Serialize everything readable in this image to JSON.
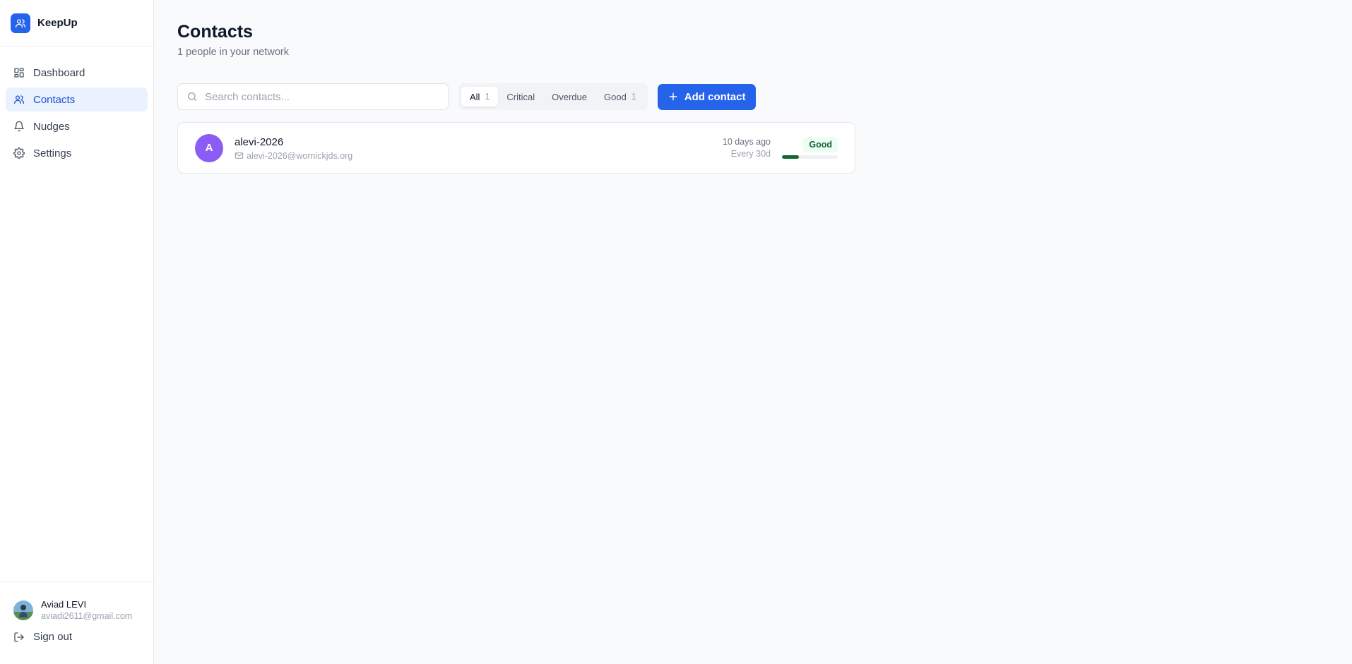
{
  "app": {
    "name": "KeepUp"
  },
  "sidebar": {
    "items": [
      {
        "label": "Dashboard",
        "icon": "dashboard-icon",
        "active": false
      },
      {
        "label": "Contacts",
        "icon": "users-icon",
        "active": true
      },
      {
        "label": "Nudges",
        "icon": "bell-icon",
        "active": false
      },
      {
        "label": "Settings",
        "icon": "gear-icon",
        "active": false
      }
    ]
  },
  "user": {
    "name": "Aviad LEVI",
    "email": "aviadi2611@gmail.com",
    "signout_label": "Sign out"
  },
  "page": {
    "title": "Contacts",
    "subtitle": "1 people in your network"
  },
  "search": {
    "placeholder": "Search contacts...",
    "value": ""
  },
  "filters": [
    {
      "label": "All",
      "count": "1",
      "active": true
    },
    {
      "label": "Critical",
      "count": "",
      "active": false
    },
    {
      "label": "Overdue",
      "count": "",
      "active": false
    },
    {
      "label": "Good",
      "count": "1",
      "active": false
    }
  ],
  "add_button": {
    "label": "Add contact"
  },
  "contacts": [
    {
      "initial": "A",
      "name": "alevi-2026",
      "email": "alevi-2026@wornickjds.org",
      "last_contact": "10 days ago",
      "frequency": "Every 30d",
      "status": "Good",
      "health_progress": 0.3,
      "avatar_color": "#8b5cf6"
    }
  ],
  "colors": {
    "accent": "#2563eb",
    "good": "#166534"
  }
}
